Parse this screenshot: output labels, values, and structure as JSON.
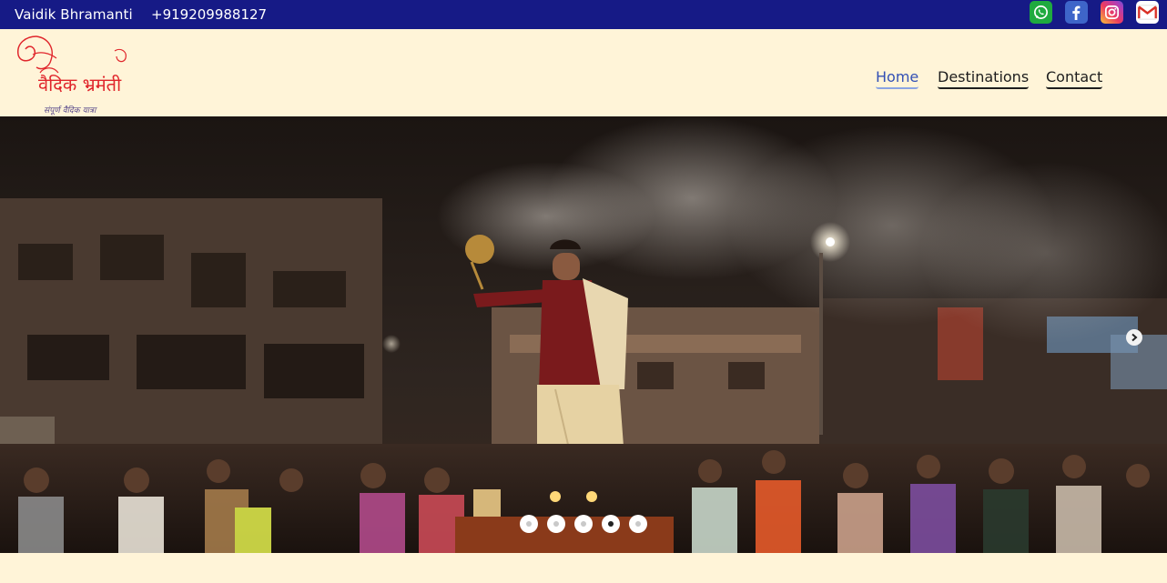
{
  "topbar": {
    "brand": "Vaidik Bhramanti",
    "phone": "+919209988127",
    "social": [
      {
        "name": "whatsapp-icon",
        "color": "#1faa3f"
      },
      {
        "name": "facebook-icon",
        "color": "#3e65c9"
      },
      {
        "name": "instagram-icon",
        "color": "#e1306c"
      },
      {
        "name": "gmail-icon",
        "color": "#d93025"
      }
    ]
  },
  "header": {
    "logo_title": "वैदिक भ्रमंती",
    "logo_tagline": "संपूर्ण वैदिक यात्रा",
    "nav": {
      "home": "Home",
      "destinations": "Destinations",
      "contact": "Contact"
    },
    "active_nav": "Home"
  },
  "hero": {
    "image_icon": "ganga-aarti-photo",
    "slide_count": 5,
    "active_slide": 4
  },
  "colors": {
    "topbar_bg": "#161a86",
    "page_bg": "#fff4d8",
    "active_link": "#3350b5",
    "logo_red": "#e0262c"
  }
}
